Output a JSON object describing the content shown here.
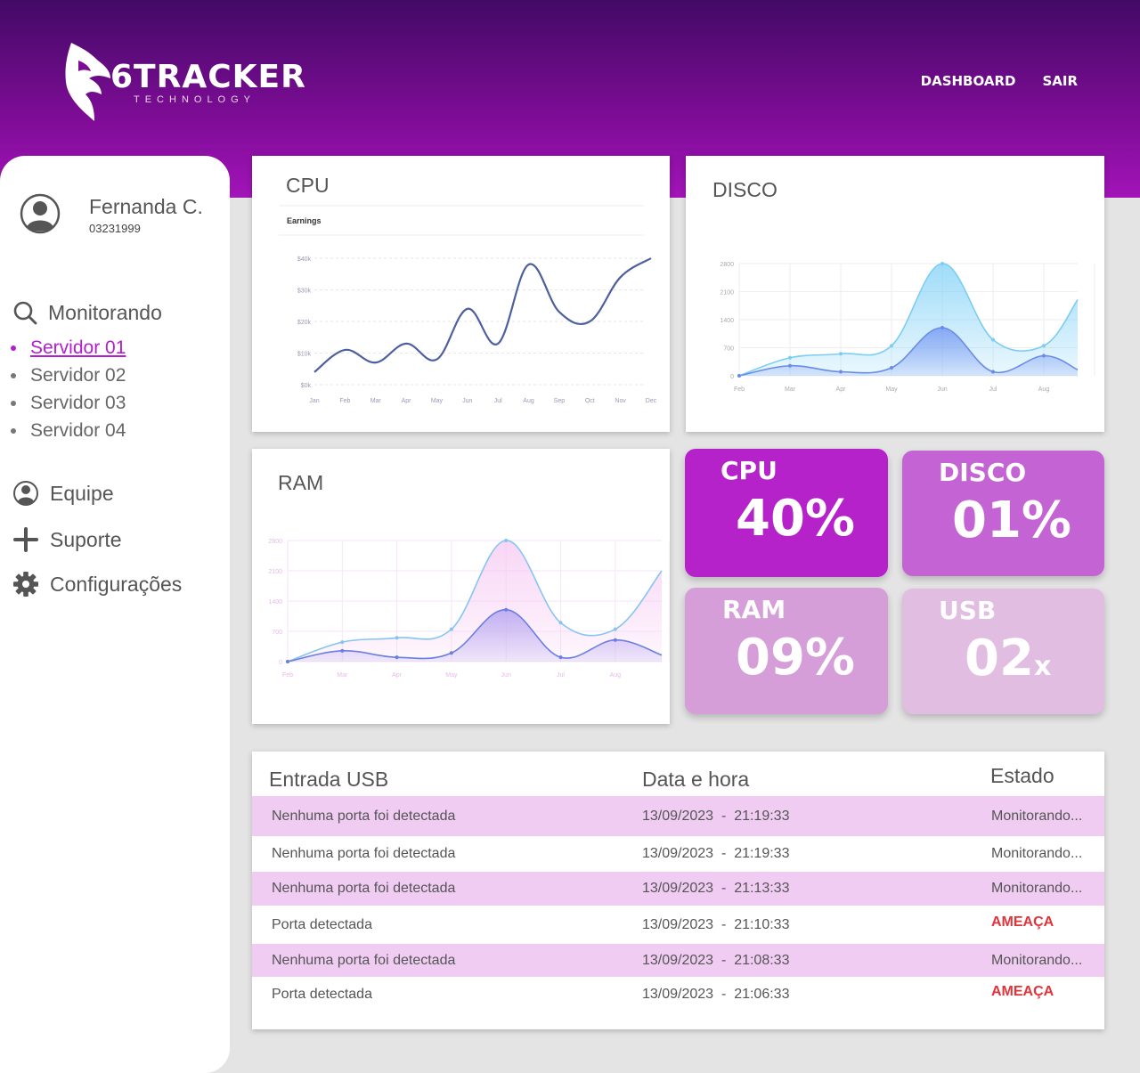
{
  "brand": {
    "name": "6TRACKER",
    "tagline": "TECHNOLOGY"
  },
  "nav": {
    "dashboard": "DASHBOARD",
    "logout": "SAIR"
  },
  "user": {
    "name": "Fernanda C.",
    "id": "03231999"
  },
  "sidebar": {
    "monitoring_label": "Monitorando",
    "servers": [
      {
        "label": "Servidor 01",
        "active": true
      },
      {
        "label": "Servidor 02",
        "active": false
      },
      {
        "label": "Servidor 03",
        "active": false
      },
      {
        "label": "Servidor 04",
        "active": false
      }
    ],
    "team_label": "Equipe",
    "support_label": "Suporte",
    "settings_label": "Configurações"
  },
  "cards": {
    "cpu_title": "CPU",
    "disk_title": "DISCO",
    "ram_title": "RAM"
  },
  "tiles": {
    "cpu": {
      "label": "CPU",
      "value": "40%"
    },
    "disk": {
      "label": "DISCO",
      "value": "01%"
    },
    "ram": {
      "label": "RAM",
      "value": "09%"
    },
    "usb": {
      "label": "USB",
      "value": "02",
      "suffix": "x"
    }
  },
  "colors": {
    "accent": "#b11fcf",
    "tile_cpu": "#b622c9",
    "tile_disk": "#c463d3",
    "tile_ram": "#d59ed9",
    "tile_usb": "#e2bde2",
    "threat": "#e0343a",
    "row_shade": "#f0ccf3"
  },
  "table": {
    "headers": {
      "usb": "Entrada USB",
      "datetime": "Data e hora",
      "status": "Estado"
    },
    "rows": [
      {
        "usb": "Nenhuma porta foi detectada",
        "datetime": "13/09/2023  -  21:19:33",
        "status": "Monitorando...",
        "threat": false
      },
      {
        "usb": "Nenhuma porta foi detectada",
        "datetime": "13/09/2023  -  21:19:33",
        "status": "Monitorando...",
        "threat": false
      },
      {
        "usb": "Nenhuma porta foi detectada",
        "datetime": "13/09/2023  -  21:13:33",
        "status": "Monitorando...",
        "threat": false
      },
      {
        "usb": "Porta detectada",
        "datetime": "13/09/2023  -  21:10:33",
        "status": "AMEAÇA",
        "threat": true
      },
      {
        "usb": "Nenhuma porta foi detectada",
        "datetime": "13/09/2023  -  21:08:33",
        "status": "Monitorando...",
        "threat": false
      },
      {
        "usb": "Porta detectada",
        "datetime": "13/09/2023  -  21:06:33",
        "status": "AMEAÇA",
        "threat": true
      }
    ]
  },
  "chart_data": [
    {
      "type": "line",
      "subtitle": "Earnings",
      "categories": [
        "Jan",
        "Feb",
        "Mar",
        "Apr",
        "May",
        "Jun",
        "Jul",
        "Aug",
        "Sep",
        "Oct",
        "Nov",
        "Dec"
      ],
      "y_ticks": [
        "$0k",
        "$10k",
        "$20k",
        "$30k",
        "$40k"
      ],
      "ylim": [
        0,
        40
      ],
      "series": [
        {
          "values": [
            4,
            11,
            7,
            13,
            8,
            24,
            13,
            38,
            23,
            20,
            34,
            40
          ]
        }
      ],
      "grid": true
    },
    {
      "type": "area",
      "categories": [
        "Feb",
        "Mar",
        "Apr",
        "May",
        "Jun",
        "Jul",
        "Aug"
      ],
      "y_ticks": [
        "0",
        "700",
        "1400",
        "2100",
        "2800"
      ],
      "ylim": [
        0,
        2800
      ],
      "series": [
        {
          "values": [
            0,
            450,
            550,
            750,
            2800,
            900,
            750,
            1900
          ]
        },
        {
          "values": [
            0,
            250,
            100,
            200,
            1200,
            100,
            500,
            150
          ]
        }
      ],
      "grid": true
    },
    {
      "type": "area",
      "categories": [
        "Feb",
        "Mar",
        "Apr",
        "May",
        "Jun",
        "Jul",
        "Aug"
      ],
      "y_ticks": [
        "0",
        "700",
        "1400",
        "2100",
        "2800"
      ],
      "ylim": [
        0,
        2800
      ],
      "series": [
        {
          "values": [
            0,
            450,
            550,
            750,
            2800,
            900,
            750,
            2100
          ]
        },
        {
          "values": [
            0,
            250,
            100,
            200,
            1200,
            100,
            500,
            150
          ]
        }
      ],
      "grid": true
    }
  ]
}
